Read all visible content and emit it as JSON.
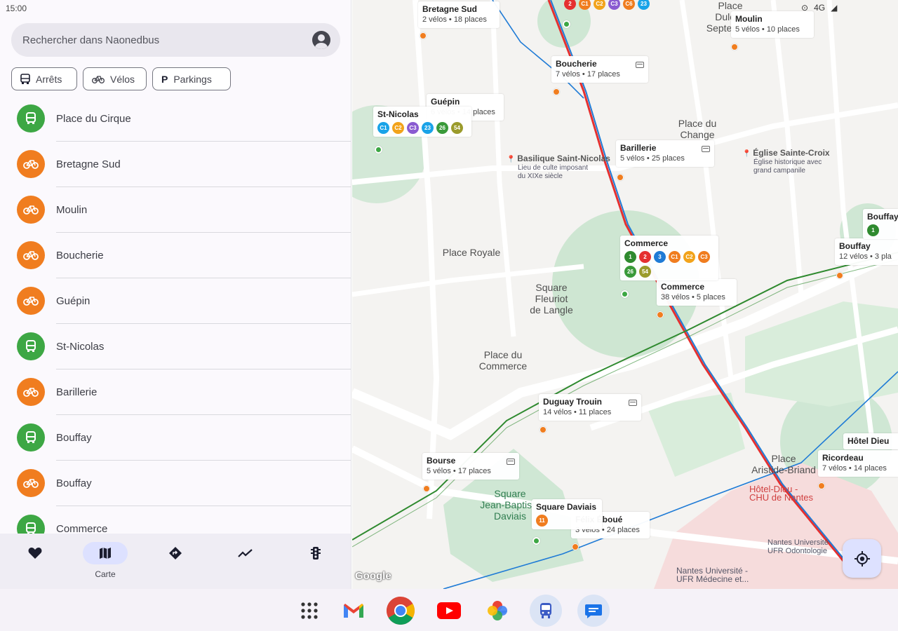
{
  "status_bar": {
    "time": "15:00",
    "network": "4G"
  },
  "search": {
    "placeholder": "Rechercher dans Naonedbus"
  },
  "chips": [
    {
      "label": "Arrêts",
      "icon": "bus-icon",
      "active": false
    },
    {
      "label": "Vélos",
      "icon": "bike-icon",
      "active": true
    },
    {
      "label": "Parkings",
      "icon": "parking-icon",
      "active": false
    }
  ],
  "list": [
    {
      "type": "bus",
      "label": "Place du Cirque"
    },
    {
      "type": "bike",
      "label": "Bretagne Sud"
    },
    {
      "type": "bike",
      "label": "Moulin"
    },
    {
      "type": "bike",
      "label": "Boucherie"
    },
    {
      "type": "bike",
      "label": "Guépin"
    },
    {
      "type": "bus",
      "label": "St-Nicolas"
    },
    {
      "type": "bike",
      "label": "Barillerie"
    },
    {
      "type": "bus",
      "label": "Bouffay"
    },
    {
      "type": "bike",
      "label": "Bouffay"
    },
    {
      "type": "bus",
      "label": "Commerce"
    }
  ],
  "bottom_nav": [
    {
      "icon": "heart-icon",
      "label": ""
    },
    {
      "icon": "map-icon",
      "label": "Carte",
      "active": true
    },
    {
      "icon": "directions-icon",
      "label": ""
    },
    {
      "icon": "trending-icon",
      "label": ""
    },
    {
      "icon": "traffic-light-icon",
      "label": ""
    }
  ],
  "map": {
    "places": {
      "place_du_change": "Place du\nChange",
      "place_royale": "Place Royale",
      "square_fleuriot": "Square\nFleuriot\nde Langle",
      "place_du_commerce": "Place du\nCommerce",
      "square_jean_baptiste": "Square\nJean-Baptiste\nDaviais",
      "place_aristide": "Place\nAristide-Briand",
      "place_dulcie": "Place\nDulcie-Septembre"
    },
    "pois": {
      "basilique_title": "Basilique Saint-Nicolas",
      "basilique_sub": "Lieu de culte imposant\ndu XIXe siècle",
      "eglise_title": "Église Sainte-Croix",
      "eglise_sub": "Église historique avec\ngrand campanile",
      "hotel_dieu_title": "Hôtel-Dieu -\nCHU de Nantes",
      "nantes_univ": "Nantes Université\nUFR Odontologie",
      "nantes_med": "Nantes Université -\nUFR Médecine et..."
    },
    "stations": [
      {
        "name": "Bretagne Sud",
        "info": "2 vélos • 18 places"
      },
      {
        "name": "Moulin",
        "info": "5 vélos • 10 places"
      },
      {
        "name": "Boucherie",
        "info": "7 vélos • 17 places"
      },
      {
        "name": "Guépin",
        "info": "6 vélos • 14 places"
      },
      {
        "name": "Barillerie",
        "info": "5 vélos • 25 places"
      },
      {
        "name": "Bouffay",
        "info": "12 vélos • 3 pla"
      },
      {
        "name": "Commerce",
        "info": "38 vélos • 5 places"
      },
      {
        "name": "Duguay Trouin",
        "info": "14 vélos • 11 places"
      },
      {
        "name": "Bourse",
        "info": "5 vélos • 17 places"
      },
      {
        "name": "Félix Éboué",
        "info": "3 vélos • 24 places"
      },
      {
        "name": "Ricordeau",
        "info": "7 vélos • 14 places"
      }
    ],
    "stops": [
      {
        "name": "St-Nicolas",
        "lines": [
          [
            "C1",
            "#1aa3e8"
          ],
          [
            "C2",
            "#f2a31b"
          ],
          [
            "C3",
            "#8a5bd1"
          ],
          [
            "23",
            "#1aa3e8"
          ],
          [
            "26",
            "#3a9a3a"
          ],
          [
            "54",
            "#9b9b2c"
          ]
        ]
      },
      {
        "name": "Commerce",
        "lines": [
          [
            "1",
            "#2f8a2f"
          ],
          [
            "2",
            "#e53030"
          ],
          [
            "3",
            "#1f7bd6"
          ],
          [
            "C1",
            "#f07d1f"
          ],
          [
            "C2",
            "#f2a31b"
          ],
          [
            "C3",
            "#f07d1f"
          ],
          [
            "26",
            "#3a9a3a"
          ],
          [
            "54",
            "#9b9b2c"
          ]
        ]
      },
      {
        "name": "Square Daviais",
        "lines": [
          [
            "11",
            "#f07d1f"
          ]
        ]
      },
      {
        "name": "Bouffay",
        "lines": [
          [
            "1",
            "#2f8a2f"
          ]
        ]
      },
      {
        "name": "Hôtel Dieu",
        "lines": []
      }
    ],
    "top_lines": [
      [
        "2",
        "#e53030"
      ],
      [
        "C1",
        "#f07d1f"
      ],
      [
        "C2",
        "#f2a31b"
      ],
      [
        "C3",
        "#8a5bd1"
      ],
      [
        "C6",
        "#f07d1f"
      ],
      [
        "23",
        "#1aa3e8"
      ]
    ],
    "attribution": "Google"
  }
}
